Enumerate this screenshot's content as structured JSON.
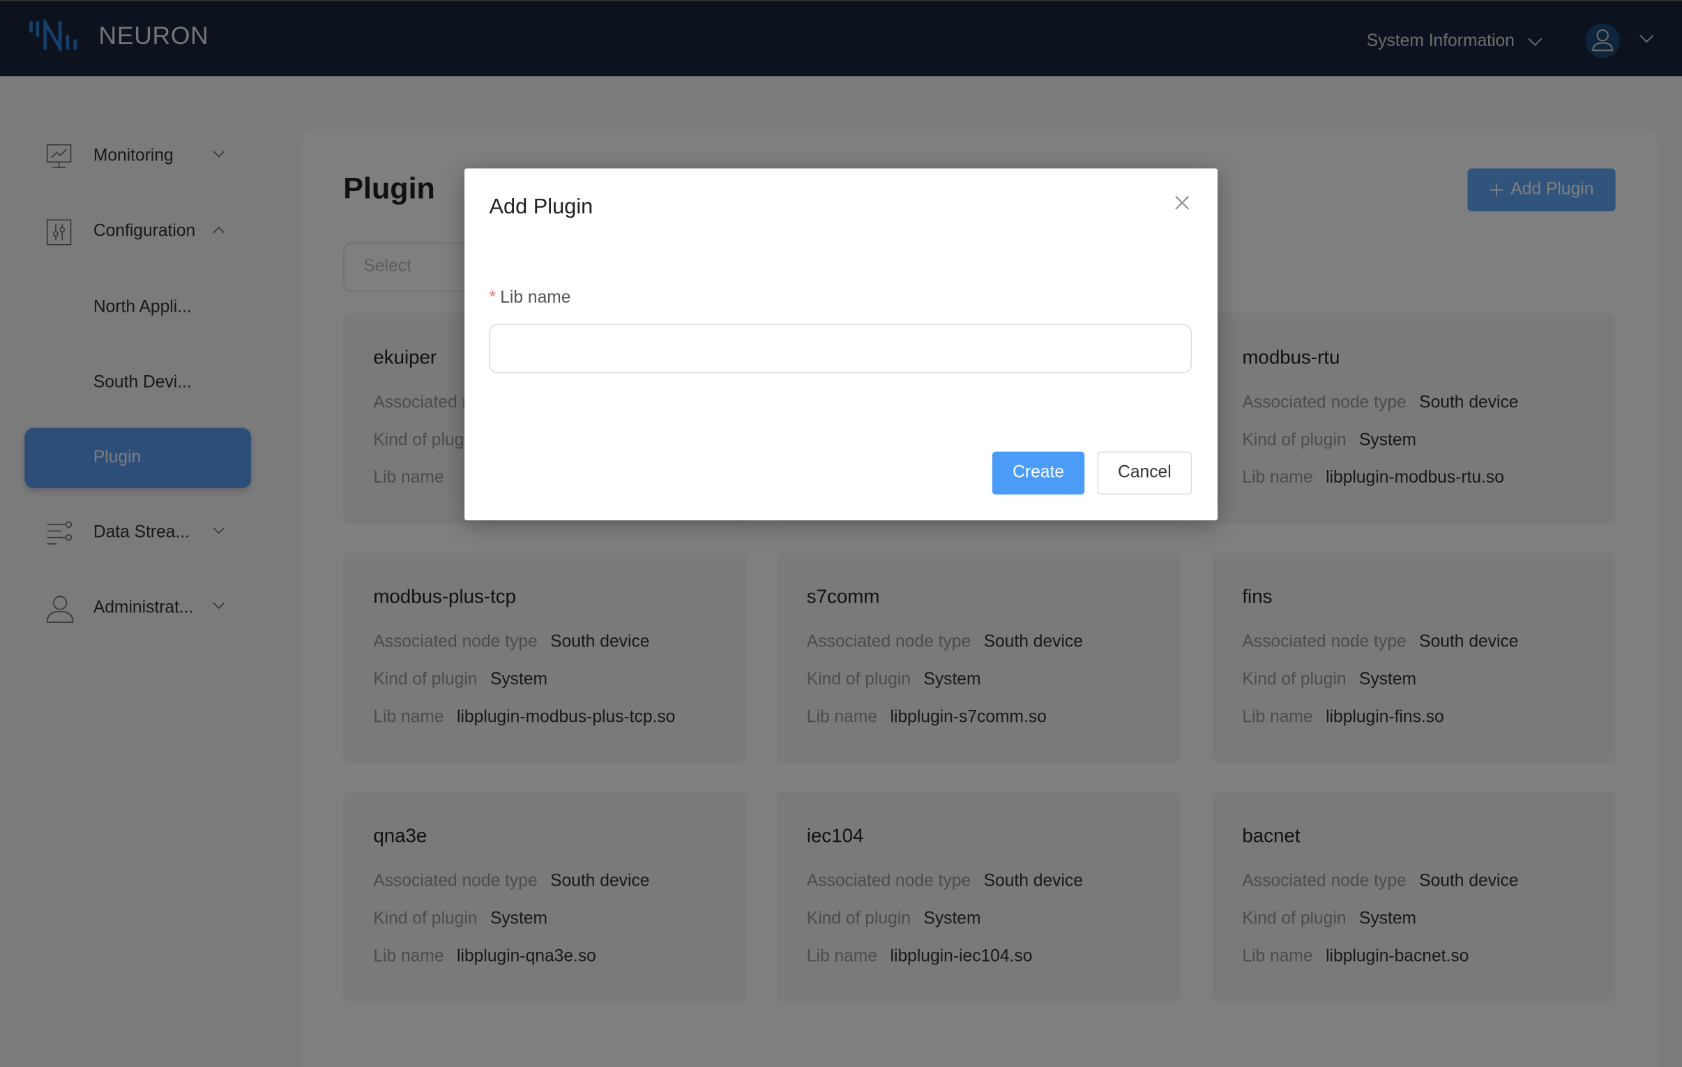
{
  "app": {
    "name": "NEURON",
    "system_info": "System Information"
  },
  "sidebar": {
    "items": [
      {
        "label": "Monitoring",
        "icon": "monitor-chart-icon",
        "chevron": "down"
      },
      {
        "label": "Configuration",
        "icon": "sliders-icon",
        "chevron": "up"
      },
      {
        "label": "North Appli..."
      },
      {
        "label": "South Devi..."
      },
      {
        "label": "Plugin",
        "active": true
      },
      {
        "label": "Data Strea...",
        "icon": "data-stream-icon",
        "chevron": "down"
      },
      {
        "label": "Administrat...",
        "icon": "user-icon",
        "chevron": "down"
      }
    ]
  },
  "page": {
    "title": "Plugin",
    "select_placeholder": "Select",
    "add_button": "Add Plugin"
  },
  "labels": {
    "node_type": "Associated node type",
    "kind": "Kind of plugin",
    "lib": "Lib name"
  },
  "cards": [
    {
      "name": "ekuiper",
      "node_type": "",
      "kind": "",
      "lib": ""
    },
    {
      "name": "",
      "node_type": "",
      "kind": "",
      "lib": ""
    },
    {
      "name": "modbus-rtu",
      "node_type": "South device",
      "kind": "System",
      "lib": "libplugin-modbus-rtu.so"
    },
    {
      "name": "modbus-plus-tcp",
      "node_type": "South device",
      "kind": "System",
      "lib": "libplugin-modbus-plus-tcp.so"
    },
    {
      "name": "s7comm",
      "node_type": "South device",
      "kind": "System",
      "lib": "libplugin-s7comm.so"
    },
    {
      "name": "fins",
      "node_type": "South device",
      "kind": "System",
      "lib": "libplugin-fins.so"
    },
    {
      "name": "qna3e",
      "node_type": "South device",
      "kind": "System",
      "lib": "libplugin-qna3e.so"
    },
    {
      "name": "iec104",
      "node_type": "South device",
      "kind": "System",
      "lib": "libplugin-iec104.so"
    },
    {
      "name": "bacnet",
      "node_type": "South device",
      "kind": "System",
      "lib": "libplugin-bacnet.so"
    }
  ],
  "modal": {
    "title": "Add Plugin",
    "field_label": "Lib name",
    "required_mark": "*",
    "field_value": "",
    "create": "Create",
    "cancel": "Cancel"
  },
  "colors": {
    "primary": "#4a9cf6",
    "header": "#18263f",
    "required": "#f56c6c"
  }
}
